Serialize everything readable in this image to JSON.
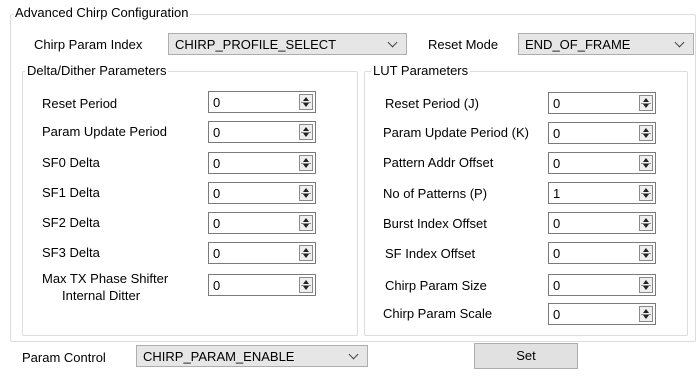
{
  "config_group": {
    "title": "Advanced Chirp Configuration"
  },
  "chirp_param_index": {
    "label": "Chirp Param Index",
    "value": "CHIRP_PROFILE_SELECT"
  },
  "reset_mode": {
    "label": "Reset Mode",
    "value": "END_OF_FRAME"
  },
  "delta_group": {
    "title": "Delta/Dither Parameters",
    "fields": [
      {
        "label": "Reset Period",
        "value": "0"
      },
      {
        "label": "Param Update Period",
        "value": "0"
      },
      {
        "label": "SF0 Delta",
        "value": "0"
      },
      {
        "label": "SF1 Delta",
        "value": "0"
      },
      {
        "label": "SF2 Delta",
        "value": "0"
      },
      {
        "label": "SF3 Delta",
        "value": "0"
      },
      {
        "label_line1": "Max TX Phase Shifter",
        "label_line2": "Internal Ditter",
        "value": "0"
      }
    ]
  },
  "lut_group": {
    "title": "LUT Parameters",
    "fields": [
      {
        "label": "Reset Period (J)",
        "value": "0"
      },
      {
        "label": "Param Update Period (K)",
        "value": "0"
      },
      {
        "label": "Pattern Addr Offset",
        "value": "0"
      },
      {
        "label": "No of Patterns (P)",
        "value": "1"
      },
      {
        "label": "Burst Index Offset",
        "value": "0"
      },
      {
        "label": "SF Index Offset",
        "value": "0"
      },
      {
        "label": "Chirp Param Size",
        "value": "0"
      },
      {
        "label": "Chirp Param Scale",
        "value": "0"
      }
    ]
  },
  "param_control": {
    "label": "Param Control",
    "value": "CHIRP_PARAM_ENABLE"
  },
  "set_button": {
    "label": "Set"
  }
}
